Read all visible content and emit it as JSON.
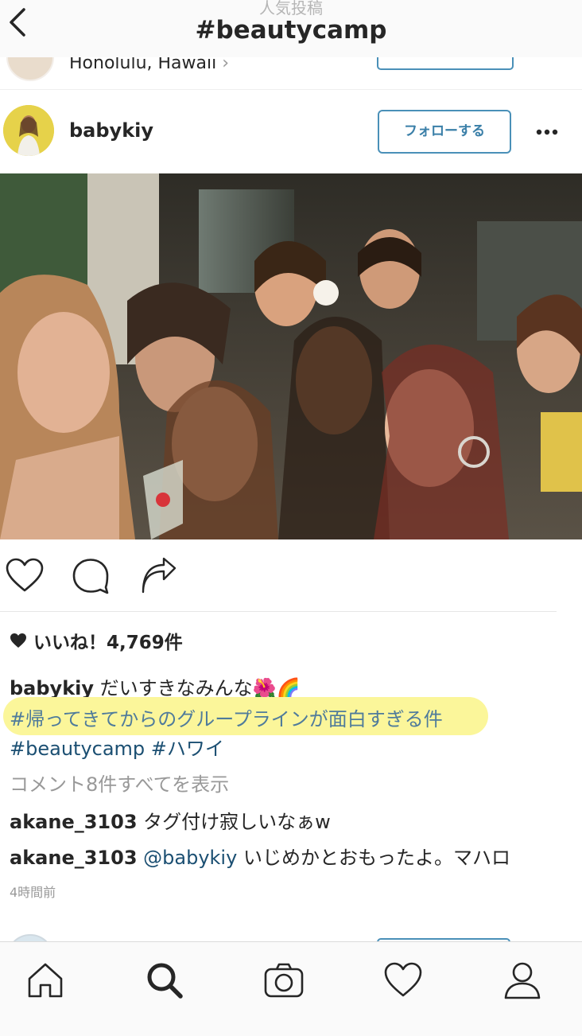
{
  "header": {
    "supertitle": "人気投稿",
    "title": "#beautycamp"
  },
  "previous_post": {
    "location": "Honolulu, Hawaii"
  },
  "post": {
    "username": "babykiy",
    "follow_label": "フォローする",
    "likes_text": "いいね！4,769件",
    "caption_user": "babykiy",
    "caption_text": "だいすきなみんな🌺🌈",
    "caption_hashtag_highlighted": "#帰ってきてからのグループラインが面白すぎる件",
    "caption_hashtags": "#beautycamp #ハワイ",
    "view_all_comments": "コメント8件すべてを表示",
    "comments": [
      {
        "user": "akane_3103",
        "mention": "",
        "text": "タグ付け寂しいなぁw"
      },
      {
        "user": "akane_3103",
        "mention": "@babykiy",
        "text": "いじめかとおもったよ。マハロ"
      }
    ],
    "timestamp": "4時間前"
  },
  "icons": {
    "back": "chevron-left-icon",
    "more": "more-horizontal-icon",
    "like": "heart-outline-icon",
    "comment": "speech-bubble-icon",
    "share": "share-arrow-icon",
    "tabs": [
      "home-icon",
      "search-icon",
      "camera-icon",
      "heart-icon",
      "profile-icon"
    ]
  },
  "colors": {
    "follow_button": "#4a90b8",
    "hashtag": "#1b4f72",
    "highlight": "#fbf69a"
  }
}
